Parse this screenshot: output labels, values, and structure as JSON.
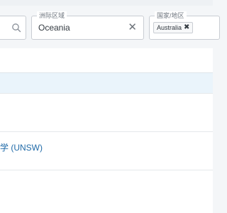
{
  "filters": {
    "search": {
      "icon": "search-icon"
    },
    "region": {
      "legend": "洲际区域",
      "value": "Oceania",
      "clear_icon": "close-icon",
      "clear_glyph": "✕"
    },
    "country": {
      "legend": "国家/地区",
      "chips": [
        {
          "label": "Australia",
          "remove_glyph": "✖"
        }
      ]
    }
  },
  "results": {
    "rows": [
      {
        "link_text": "学 (UNSW)"
      }
    ]
  },
  "colors": {
    "link": "#1f6aa8",
    "header_row": "#eaf4fb",
    "border": "#c9cdd3"
  }
}
